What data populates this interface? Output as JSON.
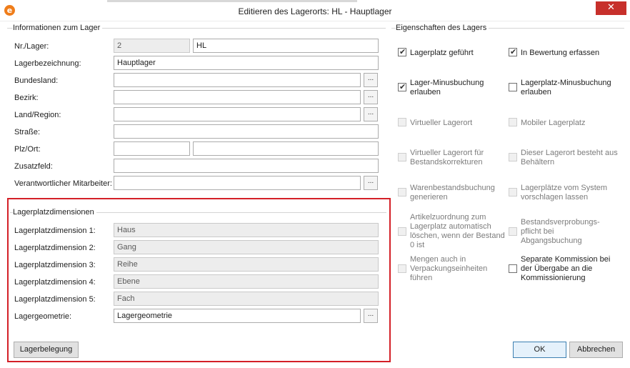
{
  "window": {
    "title": "Editieren des Lagerorts: HL - Hauptlager",
    "close_glyph": "✕",
    "app_icon_glyph": "e"
  },
  "info_group": {
    "title": "Informationen zum Lager",
    "nr_label": "Nr./Lager:",
    "nr_value": "2",
    "code_value": "HL",
    "name_label": "Lagerbezeichnung:",
    "name_value": "Hauptlager",
    "state_label": "Bundesland:",
    "state_value": "",
    "district_label": "Bezirk:",
    "district_value": "",
    "country_label": "Land/Region:",
    "country_value": "",
    "street_label": "Straße:",
    "street_value": "",
    "zip_city_label": "Plz/Ort:",
    "zip_value": "",
    "city_value": "",
    "extra_label": "Zusatzfeld:",
    "extra_value": "",
    "employee_label": "Verantwortlicher Mitarbeiter:",
    "employee_value": "",
    "ellipsis": "..."
  },
  "dimensions_group": {
    "title": "Lagerplatzdimensionen",
    "dim1_label": "Lagerplatzdimension 1:",
    "dim1_value": "Haus",
    "dim2_label": "Lagerplatzdimension 2:",
    "dim2_value": "Gang",
    "dim3_label": "Lagerplatzdimension 3:",
    "dim3_value": "Reihe",
    "dim4_label": "Lagerplatzdimension 4:",
    "dim4_value": "Ebene",
    "dim5_label": "Lagerplatzdimension 5:",
    "dim5_value": "Fach",
    "geometry_label": "Lagergeometrie:",
    "geometry_value": "Lagergeometrie",
    "occupancy_button": "Lagerbelegung"
  },
  "properties_group": {
    "title": "Eigenschaften des Lagers",
    "lagerplatz_gefuehrt": {
      "label": "Lagerplatz geführt",
      "checked": true,
      "enabled": true
    },
    "in_bewertung": {
      "label": "In Bewertung erfassen",
      "checked": true,
      "enabled": true
    },
    "lager_minus": {
      "label": "Lager-Minusbuchung\nerlauben",
      "checked": true,
      "enabled": true
    },
    "lagerplatz_minus": {
      "label": "Lagerplatz-Minusbuchung\nerlauben",
      "checked": false,
      "enabled": true
    },
    "virtueller_lagerort": {
      "label": "Virtueller Lagerort",
      "checked": false,
      "enabled": false
    },
    "mobiler_lagerplatz": {
      "label": "Mobiler Lagerplatz",
      "checked": false,
      "enabled": false
    },
    "virtueller_bestand": {
      "label": "Virtueller Lagerort für\nBestandskorrekturen",
      "checked": false,
      "enabled": false
    },
    "behaeltern": {
      "label": "Dieser Lagerort besteht aus\nBehältern",
      "checked": false,
      "enabled": false
    },
    "warenbestand": {
      "label": "Warenbestandsbuchung\ngenerieren",
      "checked": false,
      "enabled": false
    },
    "vorschlagen": {
      "label": "Lagerplätze vom System\nvorschlagen lassen",
      "checked": false,
      "enabled": false
    },
    "artikelzuordnung": {
      "label": "Artikelzuordnung zum\nLagerplatz automatisch\nlöschen, wenn der Bestand\n0 ist",
      "checked": false,
      "enabled": false
    },
    "bestandsverprobung": {
      "label": "Bestandsverprobungs-\npflicht bei\nAbgangsbuchung",
      "checked": false,
      "enabled": false
    },
    "verpackungseinheiten": {
      "label": "Mengen auch in\nVerpackungseinheiten\nführen",
      "checked": false,
      "enabled": false
    },
    "separate_kommission": {
      "label": "Separate Kommission bei\nder Übergabe an die\nKommissionierung",
      "checked": false,
      "enabled": true
    }
  },
  "footer": {
    "ok_label": "OK",
    "cancel_label": "Abbrechen"
  },
  "colors": {
    "highlight": "#d42027",
    "close_button": "#c7302b",
    "app_icon": "#ef7d1a"
  }
}
